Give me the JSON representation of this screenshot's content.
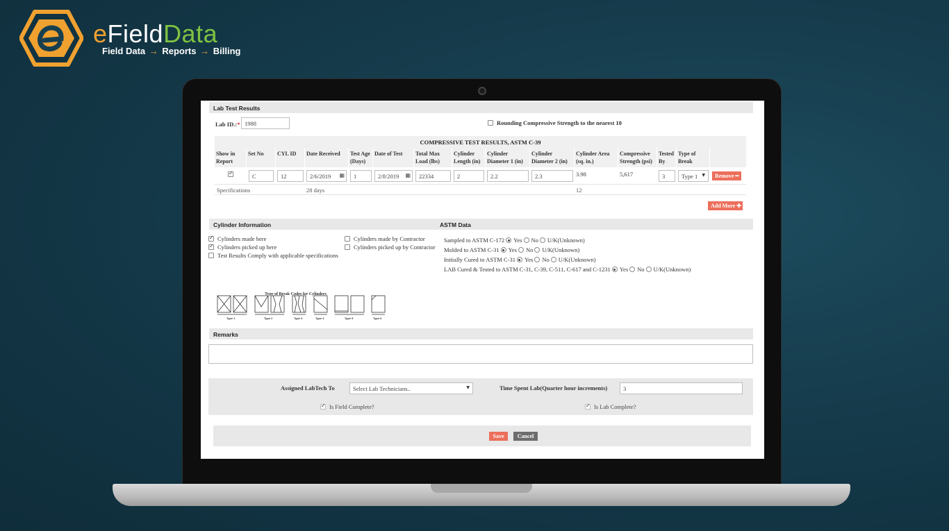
{
  "brand": {
    "name_part1": "e",
    "name_part2": "Field",
    "name_part3": "Data",
    "tag1": "Field Data",
    "tag2": "Reports",
    "tag3": "Billing",
    "arrow": "→",
    "colors": {
      "orange": "#f0a130",
      "green": "#7fc241",
      "white": "#ffffff"
    }
  },
  "form": {
    "section_title": "Lab Test Results",
    "lab_id_label": "Lab ID.:",
    "required_mark": "*",
    "lab_id_value": "1988",
    "rounding_label": "Rounding Compressive Strength to the nearest 10",
    "rounding_checked": false
  },
  "table": {
    "title": "COMPRESSIVE TEST RESULTS, ASTM C-39",
    "headers": {
      "show_in_report": [
        "Show in",
        "Report"
      ],
      "set_no": "Set No",
      "cyl_id": "CYL ID",
      "date_received": "Date Received",
      "test_age": [
        "Test Age",
        "(Days)"
      ],
      "date_of_test": "Date of Test",
      "total_max_load": [
        "Total Max",
        "Load (lbs)"
      ],
      "cylinder_length": [
        "Cylinder",
        "Length (in)"
      ],
      "cylinder_d1": [
        "Cylinder",
        "Diameter 1 (in)"
      ],
      "cylinder_d2": [
        "Cylinder",
        "Diameter 2 (in)"
      ],
      "cylinder_area": [
        "Cylinder Area",
        "(sq. in.)"
      ],
      "compressive_strength": [
        "Compressive",
        "Strength (psi)"
      ],
      "tested_by": [
        "Tested",
        "By"
      ],
      "type_of_break": [
        "Type of",
        "Break"
      ]
    },
    "row": {
      "show_in_report": true,
      "set_no": "C",
      "cyl_id": "12",
      "date_received": "2/6/2019",
      "test_age": "1",
      "date_of_test": "2/8/2019",
      "total_max_load": "22334",
      "cylinder_length": "2",
      "cylinder_d1": "2.2",
      "cylinder_d2": "2.3",
      "cylinder_area": "3.98",
      "compressive_strength": "5,617",
      "tested_by": "3",
      "type_of_break": "Type 1",
      "remove_label": "Remove"
    },
    "specs": {
      "label": "Specifications",
      "age": "28 days",
      "value": "12"
    },
    "add_more_label": "Add More"
  },
  "cylinder_info": {
    "title": "Cylinder Information",
    "items": [
      {
        "label": "Cylinders made here",
        "checked": true
      },
      {
        "label": "Cylinders picked up here",
        "checked": true
      },
      {
        "label": "Test Results Comply with applicable specifications",
        "checked": false
      },
      {
        "label": "Cylinders made by Contractor",
        "checked": false
      },
      {
        "label": "Cylinders picked up by Contractor",
        "checked": false
      }
    ]
  },
  "astm": {
    "title": "ASTM Data",
    "options": {
      "yes": "Yes",
      "no": "No",
      "unknown": "U/K(Unknown)"
    },
    "rows": [
      {
        "label": "Sampled to ASTM C-172",
        "selected": "yes"
      },
      {
        "label": "Molded to ASTM C-31",
        "selected": "yes"
      },
      {
        "label": "Initially Cured to ASTM C-31",
        "selected": "yes"
      },
      {
        "label": "LAB Cured & Tested to ASTM C-31, C-39, C-511, C-617 and C-1231",
        "selected": "yes"
      }
    ]
  },
  "break_codes": {
    "title": "Type of Break Codes for Cylinders",
    "types": [
      "Type 1",
      "Type 2",
      "Type 3",
      "Type 4",
      "Type 5",
      "Type 6"
    ]
  },
  "remarks": {
    "title": "Remarks",
    "value": ""
  },
  "assignment": {
    "labtech_label": "Assigned LabTech To",
    "labtech_value": "Select Lab Technicians..",
    "time_label": "Time Spent Lab(Quarter hour increments)",
    "time_value": "3",
    "field_complete_label": "Is Field Complete?",
    "field_complete": true,
    "lab_complete_label": "Is Lab Complete?",
    "lab_complete": true
  },
  "actions": {
    "save_label": "Save",
    "cancel_label": "Cancel",
    "save_color": "#ec6f5b",
    "cancel_color": "#6d6d6d"
  }
}
